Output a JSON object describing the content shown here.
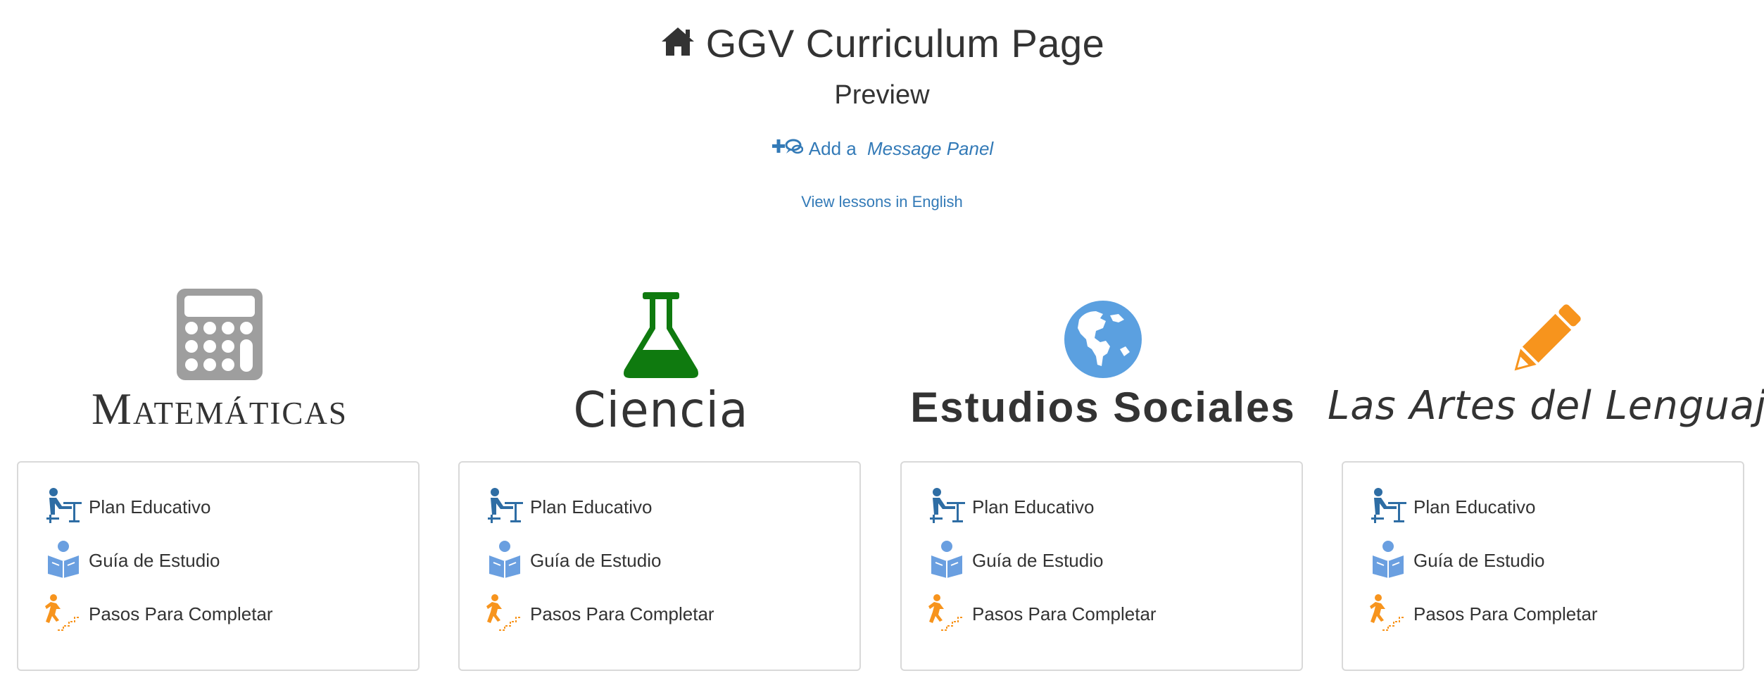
{
  "header": {
    "title": "GGV Curriculum Page",
    "subtitle": "Preview",
    "message_link": {
      "prefix": "Add a ",
      "emphasis": "Message Panel"
    },
    "language_link": "View lessons in English",
    "home_icon": "home-icon",
    "message_icon": "add-message-icon"
  },
  "colors": {
    "text": "#333333",
    "link": "#337ab7",
    "math_icon": "#9e9e9e",
    "science_icon": "#0f7a0f",
    "social_icon": "#5ba0e0",
    "arts_icon": "#f7941d",
    "plan_icon": "#2e6da4",
    "guide_icon": "#6a9fe0",
    "steps_icon": "#f7941d"
  },
  "subjects": [
    {
      "title": "Matemáticas",
      "icon": "calculator-icon",
      "links": [
        "Plan Educativo",
        "Guía de Estudio",
        "Pasos Para Completar"
      ]
    },
    {
      "title": "Ciencia",
      "icon": "flask-icon",
      "links": [
        "Plan Educativo",
        "Guía de Estudio",
        "Pasos Para Completar"
      ]
    },
    {
      "title": "Estudios Sociales",
      "icon": "globe-icon",
      "links": [
        "Plan Educativo",
        "Guía de Estudio",
        "Pasos Para Completar"
      ]
    },
    {
      "title": "Las Artes del Lenguaje",
      "icon": "pencil-icon",
      "links": [
        "Plan Educativo",
        "Guía de Estudio",
        "Pasos Para Completar"
      ]
    }
  ]
}
